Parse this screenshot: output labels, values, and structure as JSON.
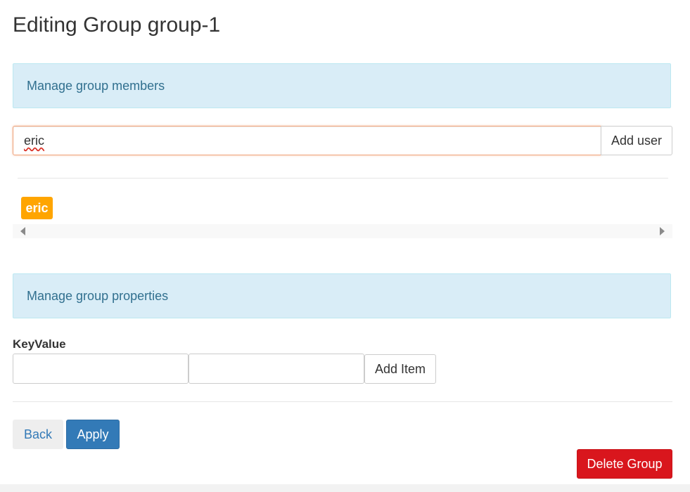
{
  "page": {
    "title": "Editing Group group-1"
  },
  "members": {
    "panel_title": "Manage group members",
    "input_value": "eric",
    "add_user_label": "Add user",
    "tags": [
      "eric"
    ],
    "tag_color": "#ffa500"
  },
  "properties": {
    "panel_title": "Manage group properties",
    "keyvalue_label": "KeyValue",
    "key_value": "",
    "value_value": "",
    "add_item_label": "Add Item"
  },
  "actions": {
    "back_label": "Back",
    "apply_label": "Apply",
    "delete_label": "Delete Group"
  },
  "colors": {
    "panel_bg": "#d9edf7",
    "panel_text": "#31708f",
    "primary": "#337ab7",
    "danger": "#d9161d"
  }
}
